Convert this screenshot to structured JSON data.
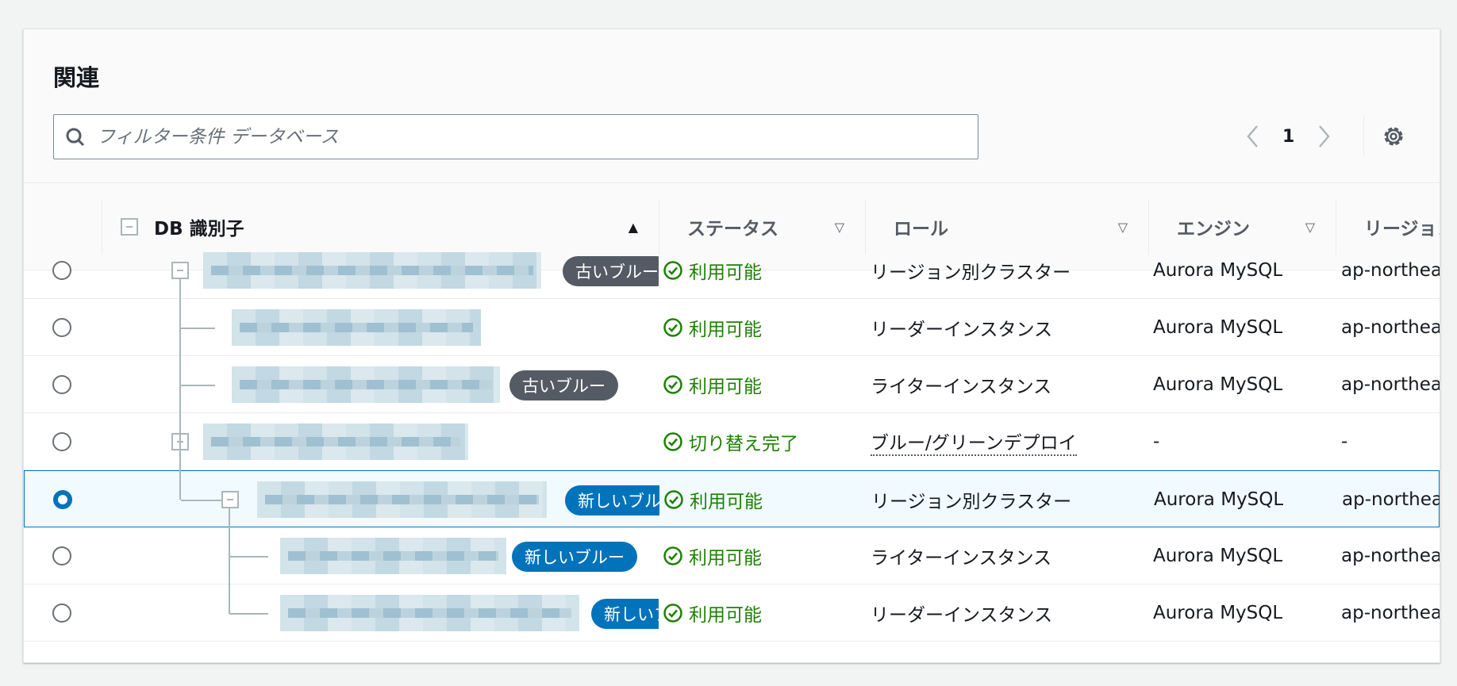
{
  "panel": {
    "title": "関連",
    "search_placeholder": "フィルター条件 データベース",
    "page": "1"
  },
  "columns": {
    "id": "DB 識別子",
    "status": "ステータス",
    "role": "ロール",
    "engine": "エンジン",
    "region": "リージョン"
  },
  "rows": [
    {
      "selected": false,
      "badge": "古いブルー",
      "badge_color": "#545b64",
      "status": "利用可能",
      "role": "リージョン別クラスター",
      "engine": "Aurora MySQL",
      "region": "ap-northeast"
    },
    {
      "selected": false,
      "badge": "",
      "status": "利用可能",
      "role": "リーダーインスタンス",
      "engine": "Aurora MySQL",
      "region": "ap-northeast"
    },
    {
      "selected": false,
      "badge": "古いブルー",
      "badge_color": "#545b64",
      "status": "利用可能",
      "role": "ライターインスタンス",
      "engine": "Aurora MySQL",
      "region": "ap-northeast"
    },
    {
      "selected": false,
      "badge": "",
      "status": "切り替え完了",
      "role": "ブルー/グリーンデプロイ",
      "engine": "-",
      "region": "-"
    },
    {
      "selected": true,
      "badge": "新しいブルー",
      "badge_color": "#0073bb",
      "status": "利用可能",
      "role": "リージョン別クラスター",
      "engine": "Aurora MySQL",
      "region": "ap-northeast"
    },
    {
      "selected": false,
      "badge": "新しいブルー",
      "badge_color": "#0073bb",
      "status": "利用可能",
      "role": "ライターインスタンス",
      "engine": "Aurora MySQL",
      "region": "ap-northeast"
    },
    {
      "selected": false,
      "badge": "新しいブルー",
      "badge_color": "#0073bb",
      "status": "利用可能",
      "role": "リーダーインスタンス",
      "engine": "Aurora MySQL",
      "region": "ap-northeast"
    }
  ],
  "colors": {
    "success": "#1d8102",
    "accent": "#0073bb"
  }
}
